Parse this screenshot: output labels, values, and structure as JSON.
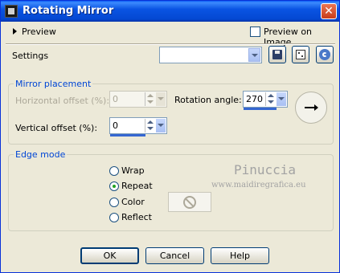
{
  "window": {
    "title": "Rotating Mirror",
    "close": "✕"
  },
  "preview": {
    "label": "Preview",
    "preview_on_image": "Preview on Image",
    "preview_on_image_checked": false
  },
  "settings": {
    "label": "Settings",
    "value": ""
  },
  "mirror": {
    "legend": "Mirror placement",
    "horizontal_label": "Horizontal offset (%):",
    "horizontal_value": "0",
    "vertical_label": "Vertical offset (%):",
    "vertical_value": "0",
    "rotation_label": "Rotation angle:",
    "rotation_value": "270"
  },
  "edge": {
    "legend": "Edge mode",
    "options": [
      "Wrap",
      "Repeat",
      "Color",
      "Reflect"
    ],
    "selected": "Repeat"
  },
  "watermark": {
    "name": "Pinuccia",
    "url": "www.maidiregrafica.eu"
  },
  "buttons": {
    "ok": "OK",
    "cancel": "Cancel",
    "help": "Help"
  },
  "icons": {
    "save": "save-icon",
    "random": "dice-icon",
    "reset": "reset-icon",
    "color": "no-color-icon"
  },
  "colors": {
    "title_bar": "#0a54e3",
    "accent": "#0046d5",
    "window_bg": "#ece9d8"
  }
}
